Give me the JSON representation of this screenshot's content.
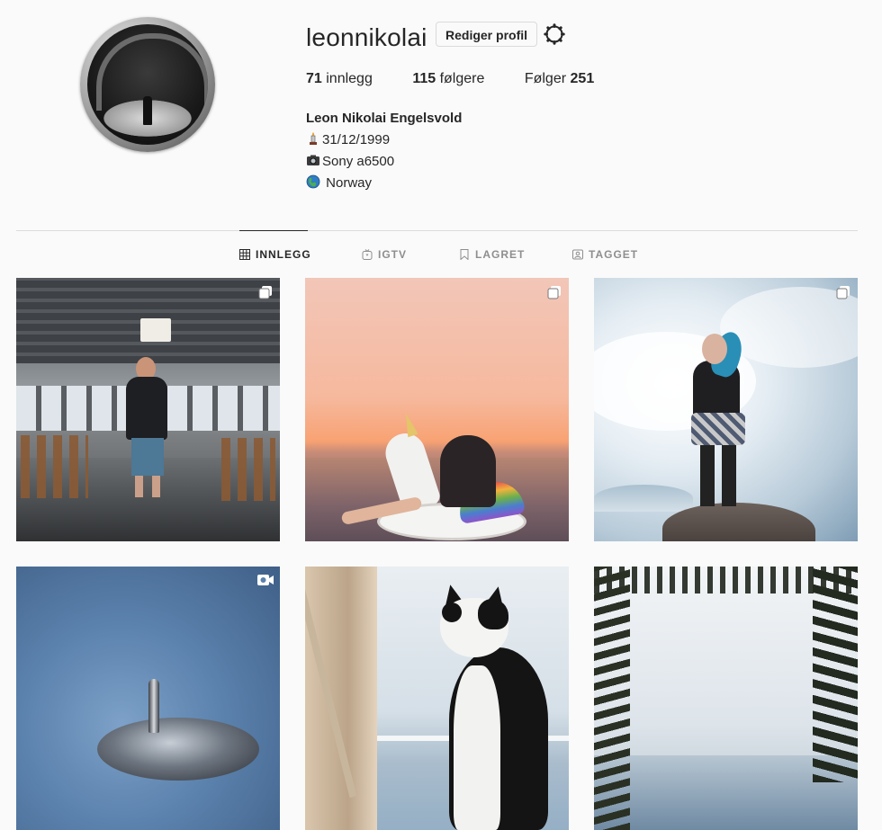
{
  "profile": {
    "username": "leonnikolai",
    "edit_label": "Rediger profil",
    "stats": {
      "posts_count": "71",
      "posts_label": "innlegg",
      "followers_count": "115",
      "followers_label": "følgere",
      "following_label": "Følger",
      "following_count": "251"
    },
    "full_name": "Leon Nikolai Engelsvold",
    "bio_lines": [
      {
        "icon": "candle-icon",
        "text": "31/12/1999"
      },
      {
        "icon": "camera-icon",
        "text": "Sony a6500"
      },
      {
        "icon": "globe-icon",
        "text": " Norway"
      }
    ]
  },
  "tabs": [
    {
      "label": "INNLEGG",
      "icon": "grid-icon",
      "active": true
    },
    {
      "label": "IGTV",
      "icon": "igtv-icon",
      "active": false
    },
    {
      "label": "LAGRET",
      "icon": "bookmark-icon",
      "active": false
    },
    {
      "label": "TAGGET",
      "icon": "tag-person-icon",
      "active": false
    }
  ],
  "posts": [
    {
      "subject": "young man standing in ferry cabin",
      "badge": "carousel-icon"
    },
    {
      "subject": "person on unicorn float at sunset",
      "badge": "carousel-icon"
    },
    {
      "subject": "girl with blue hair standing on rock",
      "badge": "carousel-icon"
    },
    {
      "subject": "spinning top on blue background",
      "badge": "video-icon"
    },
    {
      "subject": "black and white cat sitting on boat",
      "badge": ""
    },
    {
      "subject": "trees framing a lake",
      "badge": ""
    }
  ],
  "colors": {
    "background": "#fafafa",
    "text": "#262626",
    "muted": "#8e8e8e",
    "divider": "#dbdbdb"
  }
}
